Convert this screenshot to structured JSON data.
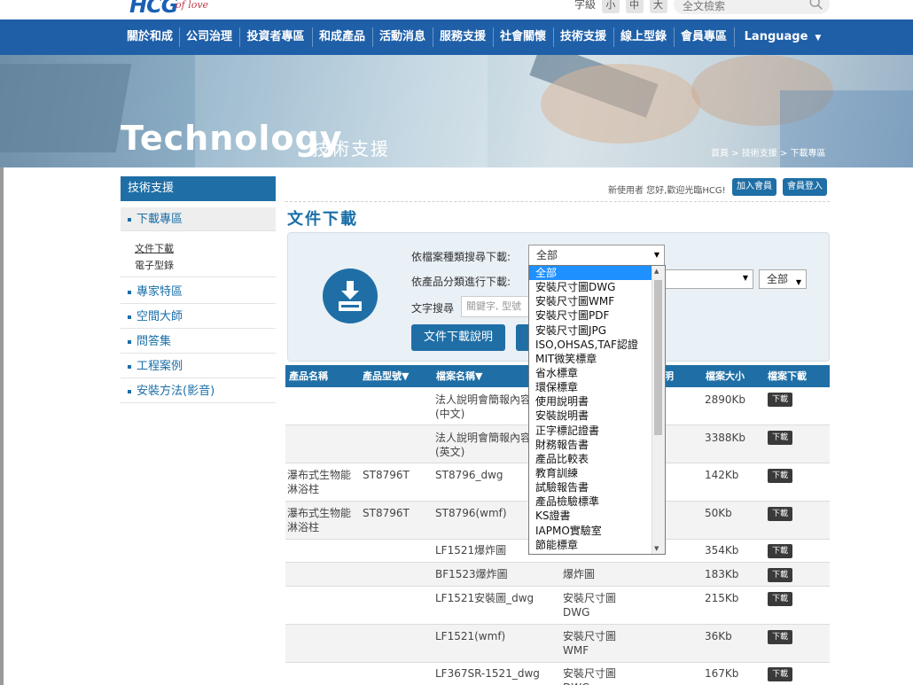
{
  "header": {
    "logo_main": "HCG",
    "logo_tagline": "the touch of love",
    "font_size_label": "字級",
    "font_sizes": [
      "小",
      "中",
      "大"
    ],
    "site_search_placeholder": "全文檢索"
  },
  "nav": {
    "items": [
      "關於和成",
      "公司治理",
      "投資者專區",
      "和成產品",
      "活動消息",
      "服務支援",
      "社會關懷",
      "技術支援",
      "線上型錄",
      "會員專區"
    ],
    "language": "Language"
  },
  "banner": {
    "title": "Technology",
    "subtitle": "技術支援",
    "breadcrumb": "首頁 > 技術支援 > 下載專區"
  },
  "sidebar": {
    "heading": "技術支援",
    "active": "下載專區",
    "subitems": [
      "文件下載",
      "電子型錄"
    ],
    "items": [
      "專家特區",
      "空間大師",
      "問答集",
      "工程案例",
      "安裝方法(影音)"
    ]
  },
  "member": {
    "greeting": "新使用者 您好,歡迎光臨HCG!",
    "join": "加入會員",
    "login": "會員登入"
  },
  "main": {
    "title": "文件下載",
    "label_type": "依檔案種類搜尋下載:",
    "label_category": "依產品分類進行下載:",
    "label_text": "文字搜尋",
    "text_placeholder": "關鍵字, 型號",
    "type_value": "全部",
    "all_value": "全部",
    "help_button": "文件下載說明"
  },
  "dropdown": {
    "options": [
      "全部",
      "安裝尺寸圖DWG",
      "安裝尺寸圖WMF",
      "安裝尺寸圖PDF",
      "安裝尺寸圖JPG",
      "ISO,OHSAS,TAF認證",
      "MIT微笑標章",
      "省水標章",
      "環保標章",
      "使用說明書",
      "安裝說明書",
      "正字標記證書",
      "財務報告書",
      "產品比較表",
      "教育訓練",
      "試驗報告書",
      "產品檢驗標準",
      "KS證書",
      "IAPMO實驗室",
      "節能標章"
    ],
    "selected": 0
  },
  "table": {
    "headers": [
      "產品名稱",
      "產品型號▼",
      "檔案名稱▼",
      "明",
      "檔案大小",
      "檔案下載"
    ],
    "download_label": "下載",
    "rows": [
      {
        "name": "",
        "model": "",
        "file": "法人說明會簡報內容(中文)",
        "type": "",
        "size": "2890Kb"
      },
      {
        "name": "",
        "model": "",
        "file": "法人說明會簡報內容(英文)",
        "type": "",
        "size": "3388Kb"
      },
      {
        "name": "瀑布式生物能淋浴柱",
        "model": "ST8796T",
        "file": "ST8796_dwg",
        "type": "",
        "size": "142Kb"
      },
      {
        "name": "瀑布式生物能淋浴柱",
        "model": "ST8796T",
        "file": "ST8796(wmf)",
        "type": "",
        "size": "50Kb"
      },
      {
        "name": "",
        "model": "",
        "file": "LF1521爆炸圖",
        "type": "",
        "size": "354Kb"
      },
      {
        "name": "",
        "model": "",
        "file": "BF1523爆炸圖",
        "type": "爆炸圖",
        "size": "183Kb"
      },
      {
        "name": "",
        "model": "",
        "file": "LF1521安裝圖_dwg",
        "type": "安裝尺寸圖DWG",
        "size": "215Kb"
      },
      {
        "name": "",
        "model": "",
        "file": "LF1521(wmf)",
        "type": "安裝尺寸圖WMF",
        "size": "36Kb"
      },
      {
        "name": "",
        "model": "",
        "file": "LF367SR-1521_dwg",
        "type": "安裝尺寸圖DWG",
        "size": "167Kb"
      }
    ]
  },
  "colors": {
    "nav_blue": "#1e5fa8",
    "accent_blue": "#1f6fa6",
    "select_blue": "#1e90ff"
  }
}
